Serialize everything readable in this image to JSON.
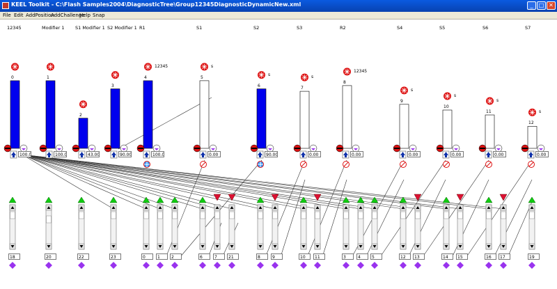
{
  "window": {
    "title": "KEEL Toolkit - C:\\Flash Samples2004\\DiagnosticTree\\Group12345DiagnosticDynamicNew.xml",
    "minimize_glyph": "_",
    "maximize_glyph": "□",
    "close_glyph": "✕"
  },
  "menu": [
    "File",
    "Edit",
    "AddPosition",
    "AddChallenge",
    "Help",
    "Snap"
  ],
  "colors": {
    "blue_bar": "#0000ee",
    "red_icon": "#dd1111",
    "green_arrow": "#11cc11",
    "red_arrow": "#dd1133",
    "purple_diamond": "#9933ee"
  },
  "columns": [
    {
      "label": "12345",
      "index": "0",
      "value": 0.83,
      "filled": true
    },
    {
      "label": "Modifier 1",
      "index": "1",
      "value": 0.83,
      "filled": true
    },
    {
      "label": "S1 Modifier 1",
      "index": "2",
      "value": 0.37,
      "filled": true
    },
    {
      "label": "S2 Modifier 1",
      "index": "3",
      "value": 0.73,
      "filled": true
    },
    {
      "label": "R1",
      "index": "4",
      "value": 0.83,
      "filled": true,
      "extra": "12345"
    },
    {
      "label": "S1",
      "index": "5",
      "value": 0.83,
      "filled": false,
      "extra": "s"
    },
    {
      "label": "S2",
      "index": "6",
      "value": 0.73,
      "filled": true,
      "extra": "s"
    },
    {
      "label": "S3",
      "index": "7",
      "value": 0.7,
      "filled": false,
      "extra": "s"
    },
    {
      "label": "R2",
      "index": "8",
      "value": 0.77,
      "filled": false,
      "extra": "12345"
    },
    {
      "label": "S4",
      "index": "9",
      "value": 0.54,
      "filled": false,
      "extra": "s"
    },
    {
      "label": "S5",
      "index": "10",
      "value": 0.47,
      "filled": false,
      "extra": "s"
    },
    {
      "label": "S6",
      "index": "11",
      "value": 0.41,
      "filled": false,
      "extra": "s"
    },
    {
      "label": "S7",
      "index": "12",
      "value": 0.27,
      "filled": false,
      "extra": "s"
    }
  ],
  "value_boxes": [
    "100.0",
    "100.0",
    "43.00",
    "90.00",
    "100.0",
    "0.00",
    "90.00",
    "0.00",
    "0.00",
    "0.00",
    "0.00",
    "0.00",
    "0.00"
  ],
  "slider_labels": [
    "18",
    "20",
    "22",
    "23",
    "0",
    "1",
    "2",
    "6",
    "7",
    "21",
    "8",
    "9",
    "10",
    "11",
    "3",
    "4",
    "5",
    "12",
    "13",
    "14",
    "15",
    "16",
    "17",
    "19"
  ],
  "slider_arrows": [
    "up",
    "up",
    "up",
    "up",
    "up",
    "up",
    "up",
    "up",
    "down",
    "down",
    "up",
    "down",
    "up",
    "down",
    "up",
    "up",
    "up",
    "up",
    "down",
    "up",
    "down",
    "up",
    "down",
    "up"
  ]
}
